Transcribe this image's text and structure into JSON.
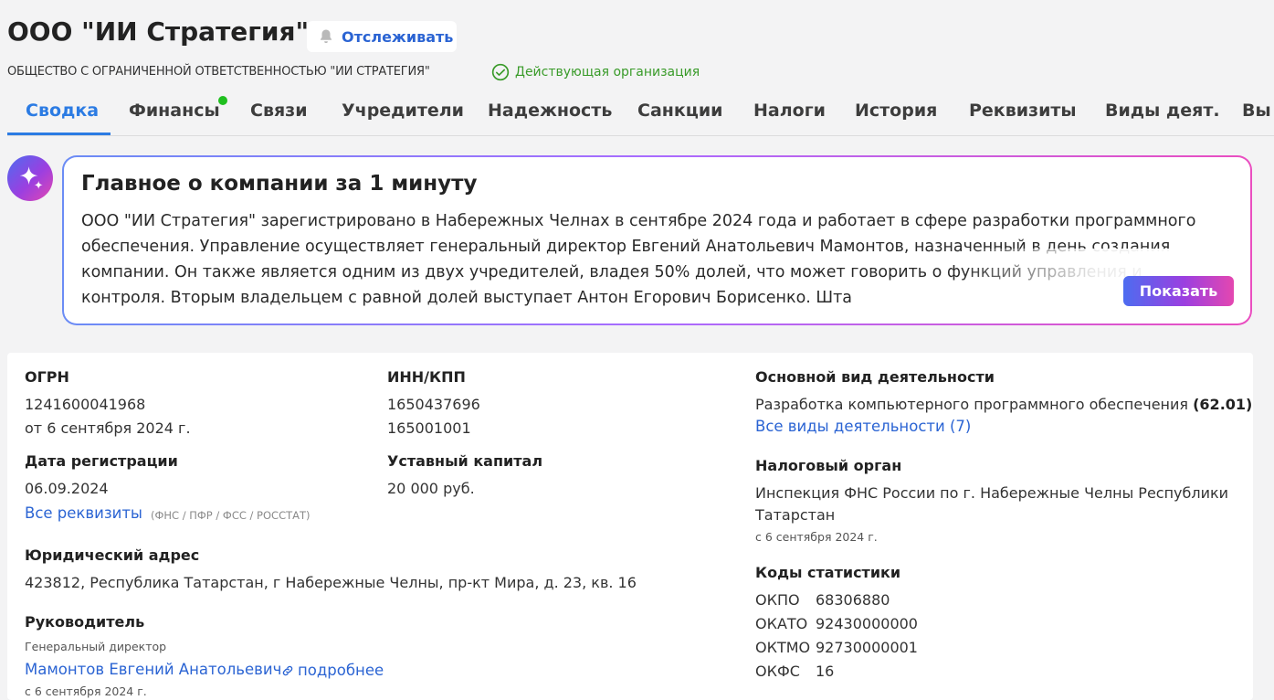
{
  "header": {
    "title": "ООО \"ИИ Стратегия\"",
    "follow_label": "Отслеживать",
    "full_name": "ОБЩЕСТВО С ОГРАНИЧЕННОЙ ОТВЕТСТВЕННОСТЬЮ \"ИИ СТРАТЕГИЯ\"",
    "status": "Действующая организация"
  },
  "tabs": [
    {
      "label": "Сводка",
      "active": true
    },
    {
      "label": "Финансы"
    },
    {
      "label": "Связи"
    },
    {
      "label": "Учредители"
    },
    {
      "label": "Надежность"
    },
    {
      "label": "Санкции"
    },
    {
      "label": "Налоги"
    },
    {
      "label": "История"
    },
    {
      "label": "Реквизиты"
    },
    {
      "label": "Виды деят."
    },
    {
      "label": "Вы"
    }
  ],
  "ai_summary": {
    "title": "Главное о компании за 1 минуту",
    "text": "ООО \"ИИ Стратегия\" зарегистрировано в Набережных Челнах в сентябре 2024 года и работает в сфере разработки программного обеспечения. Управление осуществляет генеральный директор Евгений Анатольевич Мамонтов, назначенный в день создания компании. Он также является одним из двух учредителей, владея 50% долей, что может говорить о функций управления и контроля. Вторым владельцем с равной долей выступает Антон Егорович Борисенко. Шта",
    "show_button": "Показать"
  },
  "details": {
    "ogrn_label": "ОГРН",
    "ogrn_value": "1241600041968",
    "ogrn_date": "от 6 сентября 2024 г.",
    "inn_label": "ИНН/КПП",
    "inn_value": "1650437696",
    "kpp_value": "165001001",
    "reg_date_label": "Дата регистрации",
    "reg_date_value": "06.09.2024",
    "capital_label": "Уставный капитал",
    "capital_value": "20 000 руб.",
    "all_requisites_link": "Все реквизиты",
    "requisites_sources": "(ФНС / ПФР / ФСС / РОССТАТ)",
    "address_label": "Юридический адрес",
    "address_value": "423812, Республика Татарстан, г Набережные Челны, пр-кт Мира, д. 23, кв. 16",
    "head_label": "Руководитель",
    "head_position": "Генеральный директор",
    "head_name": "Мамонтов Евгений Анатольевич",
    "head_more": "подробнее",
    "head_since": "с 6 сентября 2024 г.",
    "activity_label": "Основной вид деятельности",
    "activity_value": "Разработка компьютерного программного обеспечения",
    "activity_code": "(62.01)",
    "all_activities_link": "Все виды деятельности (7)",
    "tax_label": "Налоговый орган",
    "tax_value_line1": "Инспекция ФНС России по г. Набережные Челны Республики",
    "tax_value_line2": "Татарстан",
    "tax_since": "с 6 сентября 2024 г.",
    "stats_label": "Коды статистики",
    "stats": [
      {
        "code": "ОКПО",
        "value": "68306880"
      },
      {
        "code": "ОКАТО",
        "value": "92430000000"
      },
      {
        "code": "ОКТМО",
        "value": "92730000001"
      },
      {
        "code": "ОКФС",
        "value": "16"
      }
    ]
  },
  "colors": {
    "accent": "#2b7be3",
    "link": "#2b64d3",
    "status_green": "#3a9b2a",
    "finance_dot": "#1fbf1f"
  },
  "icons": {
    "follow": "bell-icon",
    "status": "check-circle-icon",
    "ai": "sparkle-icon",
    "more": "link-icon"
  }
}
